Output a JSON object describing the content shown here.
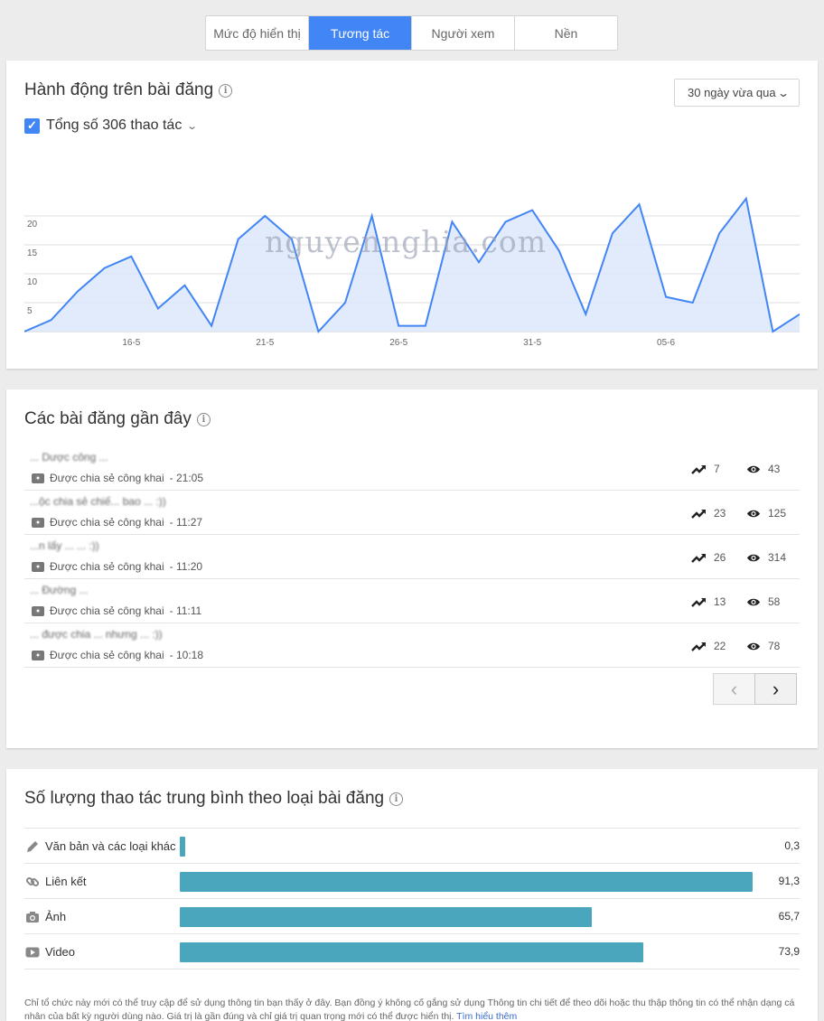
{
  "tabs": [
    {
      "label": "Mức độ hiển thị",
      "active": false
    },
    {
      "label": "Tương tác",
      "active": true
    },
    {
      "label": "Người xem",
      "active": false
    },
    {
      "label": "Nền",
      "active": false
    }
  ],
  "actions": {
    "title": "Hành động trên bài đăng",
    "range": "30 ngày vừa qua",
    "total_label": "Tổng số 306 thao tác",
    "watermark": "nguyennghia.com"
  },
  "chart_data": {
    "type": "area",
    "x": [
      "12-5",
      "13-5",
      "14-5",
      "15-5",
      "16-5",
      "17-5",
      "18-5",
      "19-5",
      "20-5",
      "21-5",
      "22-5",
      "23-5",
      "24-5",
      "25-5",
      "26-5",
      "27-5",
      "28-5",
      "29-5",
      "30-5",
      "31-5",
      "01-6",
      "02-6",
      "03-6",
      "04-6",
      "05-6",
      "06-6",
      "07-6",
      "08-6",
      "09-6",
      "10-6"
    ],
    "values": [
      0,
      2,
      7,
      11,
      13,
      4,
      8,
      1,
      16,
      20,
      16,
      0,
      5,
      20,
      1,
      1,
      19,
      12,
      19,
      21,
      14,
      3,
      17,
      22,
      6,
      5,
      17,
      23,
      0,
      3
    ],
    "x_tick_labels": [
      "16-5",
      "21-5",
      "26-5",
      "31-5",
      "05-6"
    ],
    "y_ticks": [
      5,
      10,
      15,
      20
    ],
    "ylim": [
      0,
      25
    ],
    "grid": true,
    "color": "#4285f4",
    "fill": "#dce7fb"
  },
  "posts": {
    "title": "Các bài đăng gần đây",
    "items": [
      {
        "title": "... Dược công ...",
        "visibility": "Được chia sẻ công khai",
        "time": "- 21:05",
        "engagement": "7",
        "views": "43"
      },
      {
        "title": "...ộc chia sẻ chiế... bao ... :))",
        "visibility": "Được chia sẻ công khai",
        "time": "- 11:27",
        "engagement": "23",
        "views": "125"
      },
      {
        "title": "...n lấy ... ... :))",
        "visibility": "Được chia sẻ công khai",
        "time": "- 11:20",
        "engagement": "26",
        "views": "314"
      },
      {
        "title": "... Đường ...",
        "visibility": "Được chia sẻ công khai",
        "time": "- 11:11",
        "engagement": "13",
        "views": "58"
      },
      {
        "title": "... được chia ... nhưng ... :))",
        "visibility": "Được chia sẻ công khai",
        "time": "- 10:18",
        "engagement": "22",
        "views": "78"
      }
    ],
    "prev": "‹",
    "next": "›"
  },
  "avg": {
    "title": "Số lượng thao tác trung bình theo loại bài đăng",
    "max": 91.3,
    "rows": [
      {
        "icon": "pencil-icon",
        "label": "Văn bản và các loại khác",
        "value": 0.3,
        "display": "0,3"
      },
      {
        "icon": "link-icon",
        "label": "Liên kết",
        "value": 91.3,
        "display": "91,3"
      },
      {
        "icon": "camera-icon",
        "label": "Ảnh",
        "value": 65.7,
        "display": "65,7"
      },
      {
        "icon": "video-icon",
        "label": "Video",
        "value": 73.9,
        "display": "73,9"
      }
    ],
    "bar_color": "#4aa6bc",
    "footnote": "Chỉ tổ chức này mới có thể truy cập để sử dụng thông tin bạn thấy ở đây. Bạn đồng ý không cố gắng sử dụng Thông tin chi tiết để theo dõi hoặc thu thập thông tin có thể nhận dạng cá nhân của bất kỳ người dùng nào. Giá trị là gần đúng và chỉ giá trị quan trọng mới có thể được hiển thị.",
    "learn_more": "Tìm hiểu thêm"
  }
}
